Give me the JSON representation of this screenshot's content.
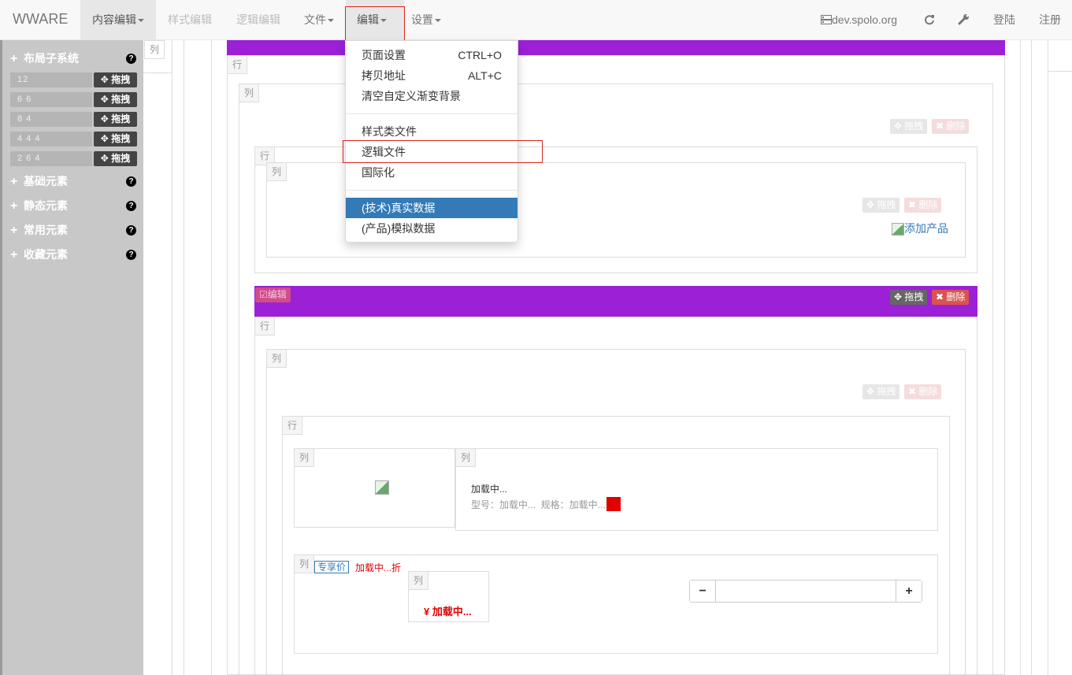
{
  "navbar": {
    "brand": "WWARE",
    "items": [
      {
        "label": "内容编辑"
      },
      {
        "label": "样式编辑"
      },
      {
        "label": "逻辑编辑"
      },
      {
        "label": "文件"
      },
      {
        "label": "编辑"
      },
      {
        "label": "设置"
      }
    ],
    "server": "dev.spolo.org",
    "login": "登陆",
    "register": "注册",
    "icons": [
      "server-icon",
      "refresh-icon",
      "wrench-icon"
    ]
  },
  "sidebar": {
    "layout_title": "布局子系统",
    "layouts": [
      {
        "value": "12",
        "drag": "拖拽"
      },
      {
        "value": "6 6",
        "drag": "拖拽"
      },
      {
        "value": "8 4",
        "drag": "拖拽"
      },
      {
        "value": "4 4 4",
        "drag": "拖拽"
      },
      {
        "value": "2 6 4",
        "drag": "拖拽"
      }
    ],
    "sections": [
      "基础元素",
      "静态元素",
      "常用元素",
      "收藏元素"
    ]
  },
  "dropdown": {
    "items": [
      {
        "label": "页面设置",
        "shortcut": "CTRL+O"
      },
      {
        "label": "拷贝地址",
        "shortcut": "ALT+C"
      },
      {
        "label": "清空自定义渐变背景"
      },
      {
        "label": "样式类文件"
      },
      {
        "label": "逻辑文件"
      },
      {
        "label": "国际化"
      },
      {
        "label": "(技术)真实数据"
      },
      {
        "label": "(产品)模拟数据"
      }
    ]
  },
  "canvas": {
    "row_tag": "行",
    "col_tag": "列",
    "drag_label": "拖拽",
    "delete_label": "删除",
    "edit_label": "编辑",
    "add_product": "添加产品",
    "loading": "加载中...",
    "model_line": "型号：加载中...  规格：加载中...",
    "exclusive_price": "专享价",
    "discount": "加载中...折",
    "price": "¥ 加载中..."
  },
  "colors": {
    "purple_bar": "#9b20d6",
    "accent_blue": "#337ab7",
    "red": "#e00000"
  }
}
